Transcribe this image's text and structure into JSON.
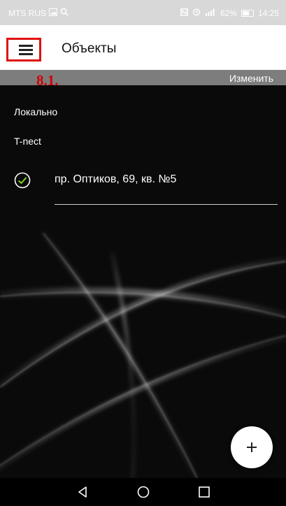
{
  "status_bar": {
    "carrier": "MTS RUS",
    "battery": "62%",
    "time": "14:25"
  },
  "app_bar": {
    "title": "Объекты",
    "menu_icon": "hamburger-menu-icon"
  },
  "annotation": "8.1.",
  "toolbar": {
    "edit_label": "Изменить"
  },
  "groups": [
    {
      "label": "Локально"
    },
    {
      "label": "T-nect"
    }
  ],
  "items": [
    {
      "label": "пр. Оптиков, 69, кв. №5",
      "icon": "check-circle-icon"
    }
  ],
  "fab": {
    "icon": "plus-icon"
  },
  "colors": {
    "highlight": "#e01010",
    "annotation": "#d00000",
    "strip": "#7d7d7d",
    "background": "#0a0a0a"
  }
}
